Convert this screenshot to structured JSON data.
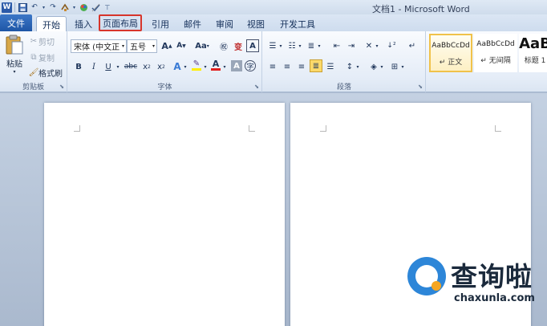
{
  "window": {
    "title": "文档1 - Microsoft Word"
  },
  "qat": {
    "icons": [
      "word-logo-icon",
      "save-icon",
      "undo-icon",
      "redo-icon",
      "format-painter-icon",
      "color-icon",
      "check-icon",
      "customize-icon"
    ],
    "logo_text": "W"
  },
  "tabs": [
    {
      "label": "文件"
    },
    {
      "label": "开始"
    },
    {
      "label": "插入"
    },
    {
      "label": "页面布局"
    },
    {
      "label": "引用"
    },
    {
      "label": "邮件"
    },
    {
      "label": "审阅"
    },
    {
      "label": "视图"
    },
    {
      "label": "开发工具"
    }
  ],
  "clipboard": {
    "paste": "粘贴",
    "cut": "剪切",
    "copy": "复制",
    "format_painter": "格式刷",
    "label": "剪贴板"
  },
  "font": {
    "font_name": "宋体 (中文正",
    "font_size": "五号",
    "grow": "A",
    "shrink": "A",
    "change_case": "Aa",
    "clear": "A",
    "bold": "B",
    "italic": "I",
    "underline": "U",
    "strike": "abc",
    "subscript": "x",
    "superscript": "x",
    "text_effects": "A",
    "font_color": "A",
    "char_shading": "A",
    "label": "字体"
  },
  "paragraph": {
    "label": "段落"
  },
  "styles": {
    "items": [
      {
        "sample": "AaBbCcDd",
        "name": "↵ 正文"
      },
      {
        "sample": "AaBbCcDd",
        "name": "↵ 无间隔"
      },
      {
        "sample": "AaB",
        "name": "标题 1"
      }
    ]
  },
  "watermark": {
    "cn": "查询啦",
    "en": "chaxunla.com"
  },
  "colors": {
    "file_tab": "#2b64b5",
    "highlight_border": "#d7352b",
    "font_color_bar": "#e02020",
    "highlight_bar": "#ffee00"
  }
}
